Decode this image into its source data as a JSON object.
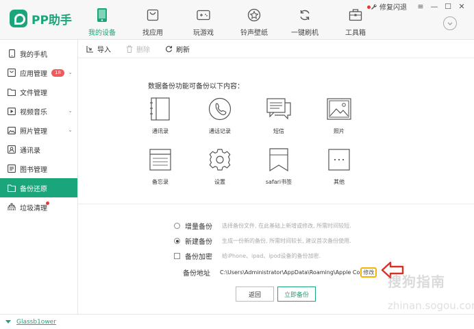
{
  "app": {
    "name": "PP助手",
    "accent": "#1aa67a"
  },
  "nav": [
    {
      "label": "我的设备",
      "icon": "phone-icon",
      "active": true
    },
    {
      "label": "找应用",
      "icon": "shopping-bag-icon",
      "active": false
    },
    {
      "label": "玩游戏",
      "icon": "gamepad-icon",
      "active": false
    },
    {
      "label": "铃声壁纸",
      "icon": "star-icon",
      "active": false
    },
    {
      "label": "一键刷机",
      "icon": "refresh-icon",
      "active": false
    },
    {
      "label": "工具箱",
      "icon": "toolbox-icon",
      "active": false
    }
  ],
  "window": {
    "repair_label": "修复闪退"
  },
  "sidebar": [
    {
      "label": "我的手机",
      "icon": "phone-icon"
    },
    {
      "label": "应用管理",
      "icon": "app-icon",
      "badge": "18"
    },
    {
      "label": "文件管理",
      "icon": "folder-icon"
    },
    {
      "label": "视频音乐",
      "icon": "video-icon"
    },
    {
      "label": "照片管理",
      "icon": "photo-icon"
    },
    {
      "label": "通讯录",
      "icon": "contacts-icon"
    },
    {
      "label": "图书管理",
      "icon": "book-icon"
    },
    {
      "label": "备份还原",
      "icon": "backup-icon",
      "active": true
    },
    {
      "label": "垃圾清理",
      "icon": "broom-icon"
    }
  ],
  "toolbar": {
    "import": "导入",
    "delete": "删除",
    "refresh": "刷新"
  },
  "main": {
    "intro": "数据备份功能可备份以下内容：",
    "items": [
      "通讯录",
      "通话记录",
      "短信",
      "照片",
      "备忘录",
      "设置",
      "safari书签",
      "其他"
    ],
    "options": {
      "incremental": {
        "label": "增量备份",
        "desc": "选择备份文件, 在此基础上新增或修改, 所需时间较短."
      },
      "new": {
        "label": "新建备份",
        "desc": "生成一份新的备份, 所需时间较长, 建议首次备份使用."
      },
      "encrypt": {
        "label": "备份加密",
        "desc": "给iPhone、ipad、ipod设备的备份加密."
      }
    },
    "path_label": "备份地址",
    "path_value": "C:\\Users\\Administrator\\AppData\\Roaming\\Apple Co",
    "modify": "修改",
    "back_button": "返回",
    "backup_button": "立即备份"
  },
  "watermark": {
    "title": "搜狗指南",
    "url": "zhinan.sogou.com"
  },
  "footer": {
    "device_name": "Glassb1ower"
  }
}
